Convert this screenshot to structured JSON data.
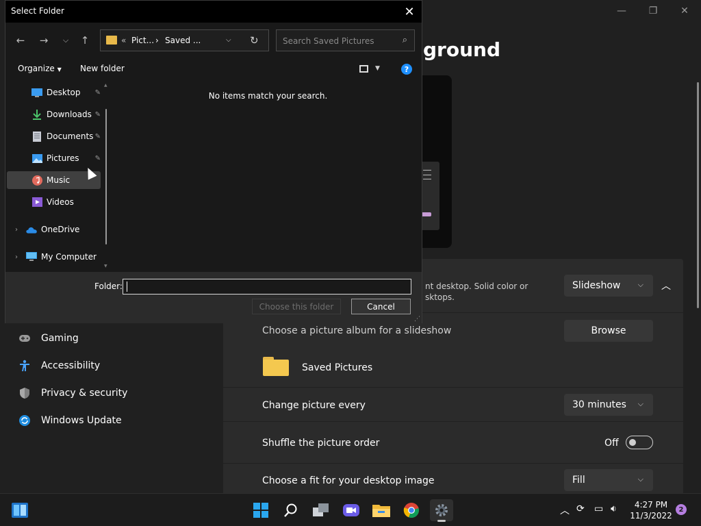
{
  "settings": {
    "title_partial": "ground",
    "controls": {
      "minimize": "—",
      "maximize": "❐",
      "close": "✕"
    },
    "background_row": {
      "desc_line1": "nt desktop. Solid color or",
      "desc_line2": "sktops.",
      "value": "Slideshow"
    },
    "album_row": {
      "label": "Choose a picture album for a slideshow",
      "button": "Browse"
    },
    "album": {
      "name": "Saved Pictures"
    },
    "interval_row": {
      "label": "Change picture every",
      "value": "30 minutes"
    },
    "shuffle_row": {
      "label": "Shuffle the picture order",
      "state": "Off"
    },
    "fit_row": {
      "label": "Choose a fit for your desktop image",
      "value": "Fill"
    },
    "nav": [
      {
        "label": "Gaming",
        "icon": "gamepad-icon"
      },
      {
        "label": "Accessibility",
        "icon": "accessibility-icon"
      },
      {
        "label": "Privacy & security",
        "icon": "shield-icon"
      },
      {
        "label": "Windows Update",
        "icon": "update-icon"
      }
    ]
  },
  "dialog": {
    "title": "Select Folder",
    "address": {
      "overflow": "«",
      "crumb1": "Pict...",
      "crumb_sep": "›",
      "crumb2": "Saved ..."
    },
    "search_placeholder": "Search Saved Pictures",
    "toolbar": {
      "organize": "Organize",
      "new_folder": "New folder",
      "help": "?"
    },
    "nav_pane": [
      {
        "label": "Desktop",
        "icon": "desktop-icon",
        "pinned": true
      },
      {
        "label": "Downloads",
        "icon": "download-icon",
        "pinned": true
      },
      {
        "label": "Documents",
        "icon": "document-icon",
        "pinned": true
      },
      {
        "label": "Pictures",
        "icon": "pictures-icon",
        "pinned": true
      },
      {
        "label": "Music",
        "icon": "music-icon",
        "pinned": false,
        "selected": true
      },
      {
        "label": "Videos",
        "icon": "videos-icon",
        "pinned": false
      },
      {
        "label": "OneDrive",
        "icon": "onedrive-icon",
        "expandable": true
      },
      {
        "label": "My Computer",
        "icon": "computer-icon",
        "expandable": true
      }
    ],
    "empty_message": "No items match your search.",
    "folder_label": "Folder:",
    "folder_value": "",
    "choose_button": "Choose this folder",
    "cancel_button": "Cancel"
  },
  "taskbar": {
    "time": "4:27 PM",
    "date": "11/3/2022",
    "notifications": "2"
  },
  "colors": {
    "accent_blue": "#1e90ff",
    "folder_yellow": "#e8b94a",
    "badge_purple": "#b57ee0"
  }
}
